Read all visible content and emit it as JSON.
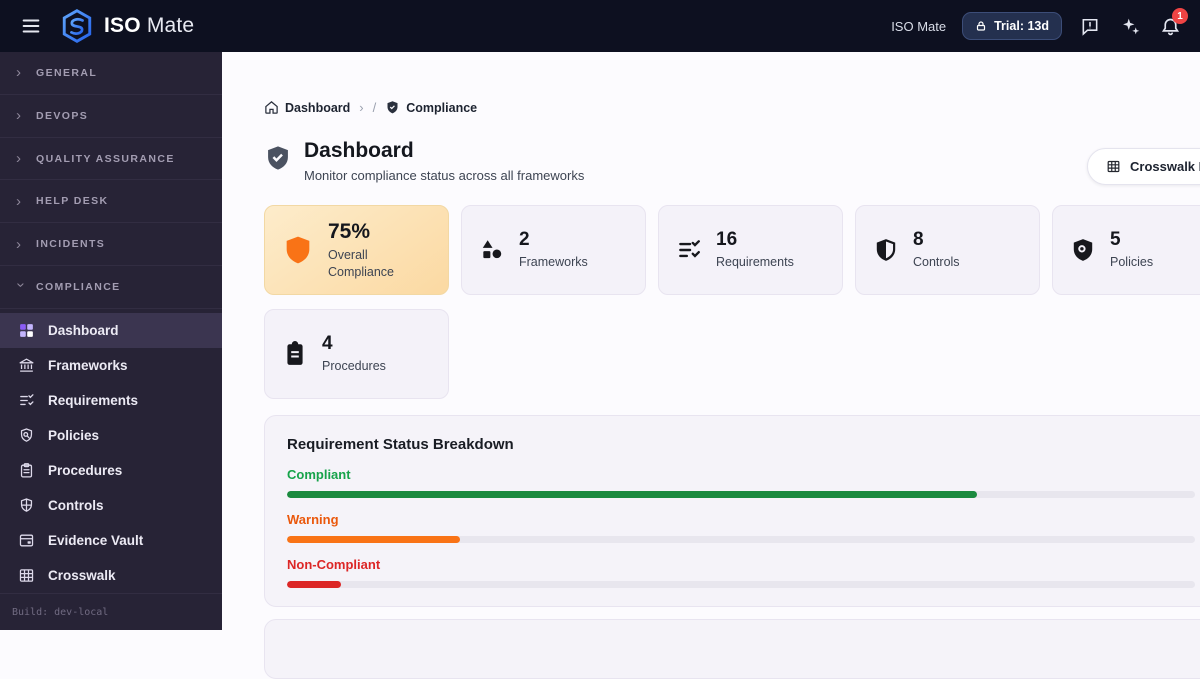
{
  "topbar": {
    "logo_bold": "ISO",
    "logo_light": "Mate",
    "org_name": "ISO Mate",
    "trial_label": "Trial: 13d",
    "notification_count": "1"
  },
  "sidebar": {
    "sections": [
      {
        "label": "GENERAL"
      },
      {
        "label": "DEVOPS"
      },
      {
        "label": "QUALITY ASSURANCE"
      },
      {
        "label": "HELP DESK"
      },
      {
        "label": "INCIDENTS"
      },
      {
        "label": "COMPLIANCE"
      }
    ],
    "items": [
      {
        "label": "Dashboard"
      },
      {
        "label": "Frameworks"
      },
      {
        "label": "Requirements"
      },
      {
        "label": "Policies"
      },
      {
        "label": "Procedures"
      },
      {
        "label": "Controls"
      },
      {
        "label": "Evidence Vault"
      },
      {
        "label": "Crosswalk"
      }
    ],
    "build_label": "Build: dev-local"
  },
  "breadcrumb": {
    "home": "Dashboard",
    "current": "Compliance"
  },
  "page": {
    "title": "Dashboard",
    "subtitle": "Monitor compliance status across all frameworks",
    "action": "Crosswalk Matrix"
  },
  "stats": [
    {
      "value": "75%",
      "label": "Overall Compliance"
    },
    {
      "value": "2",
      "label": "Frameworks"
    },
    {
      "value": "16",
      "label": "Requirements"
    },
    {
      "value": "8",
      "label": "Controls"
    },
    {
      "value": "5",
      "label": "Policies"
    },
    {
      "value": "4",
      "label": "Procedures"
    }
  ],
  "breakdown": {
    "title": "Requirement Status Breakdown",
    "rows": [
      {
        "label": "Compliant",
        "color": "#16a34a",
        "bar_color": "#1b8a3f",
        "percent": 76
      },
      {
        "label": "Warning",
        "color": "#ea580c",
        "bar_color": "#f97316",
        "percent": 19
      },
      {
        "label": "Non-Compliant",
        "color": "#dc2626",
        "bar_color": "#dc2626",
        "percent": 6
      }
    ]
  },
  "colors": {
    "brand": "#3b82f6"
  }
}
